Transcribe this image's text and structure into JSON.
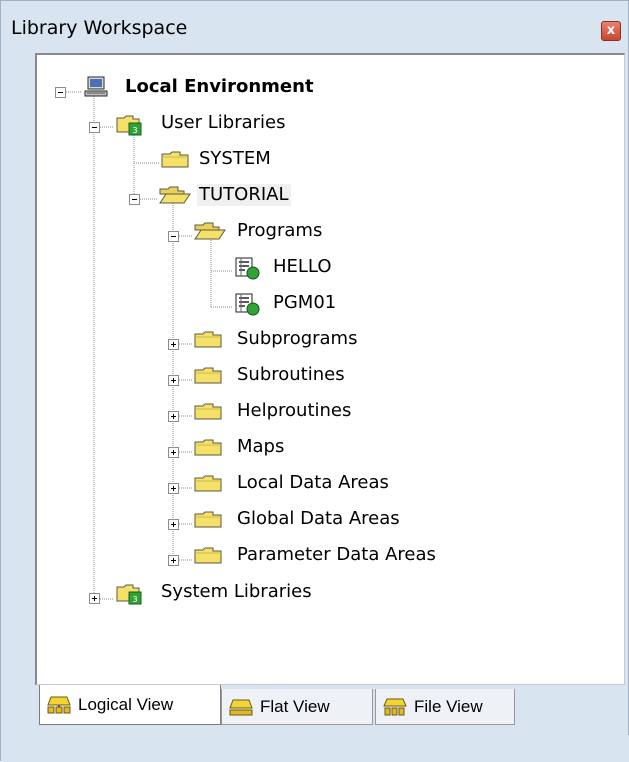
{
  "window": {
    "title": "Library Workspace",
    "close_label": "x"
  },
  "tree": {
    "nodes": [
      {
        "id": "local-environment",
        "label": "Local Environment",
        "icon": "computer-icon",
        "expander": "minus",
        "bold": true
      },
      {
        "id": "user-libraries",
        "label": "User Libraries",
        "icon": "library-folder-icon",
        "expander": "minus"
      },
      {
        "id": "system",
        "label": "SYSTEM",
        "icon": "folder-icon",
        "expander": "none"
      },
      {
        "id": "tutorial",
        "label": "TUTORIAL",
        "icon": "open-folder-icon",
        "expander": "minus",
        "selected": true
      },
      {
        "id": "programs",
        "label": "Programs",
        "icon": "open-folder-icon",
        "expander": "minus"
      },
      {
        "id": "hello",
        "label": "HELLO",
        "icon": "program-icon",
        "expander": "none"
      },
      {
        "id": "pgm01",
        "label": "PGM01",
        "icon": "program-icon",
        "expander": "none"
      },
      {
        "id": "subprograms",
        "label": "Subprograms",
        "icon": "folder-icon",
        "expander": "plus"
      },
      {
        "id": "subroutines",
        "label": "Subroutines",
        "icon": "folder-icon",
        "expander": "plus"
      },
      {
        "id": "helproutines",
        "label": "Helproutines",
        "icon": "folder-icon",
        "expander": "plus"
      },
      {
        "id": "maps",
        "label": "Maps",
        "icon": "folder-icon",
        "expander": "plus"
      },
      {
        "id": "local-data-areas",
        "label": "Local Data Areas",
        "icon": "folder-icon",
        "expander": "plus"
      },
      {
        "id": "global-data-areas",
        "label": "Global Data Areas",
        "icon": "folder-icon",
        "expander": "plus"
      },
      {
        "id": "parameter-data-areas",
        "label": "Parameter Data Areas",
        "icon": "folder-icon",
        "expander": "plus"
      },
      {
        "id": "system-libraries",
        "label": "System Libraries",
        "icon": "library-folder-icon",
        "expander": "plus"
      }
    ]
  },
  "tabs": [
    {
      "id": "logical-view",
      "label": "Logical View",
      "icon": "logical-view-icon",
      "active": true
    },
    {
      "id": "flat-view",
      "label": "Flat View",
      "icon": "flat-view-icon",
      "active": false
    },
    {
      "id": "file-view",
      "label": "File View",
      "icon": "file-view-icon",
      "active": false
    }
  ],
  "colors": {
    "panel_background": "#d9e4f1",
    "folder_yellow": "#f5e06a",
    "library_green": "#2fa335",
    "close_button": "#d05a44"
  }
}
